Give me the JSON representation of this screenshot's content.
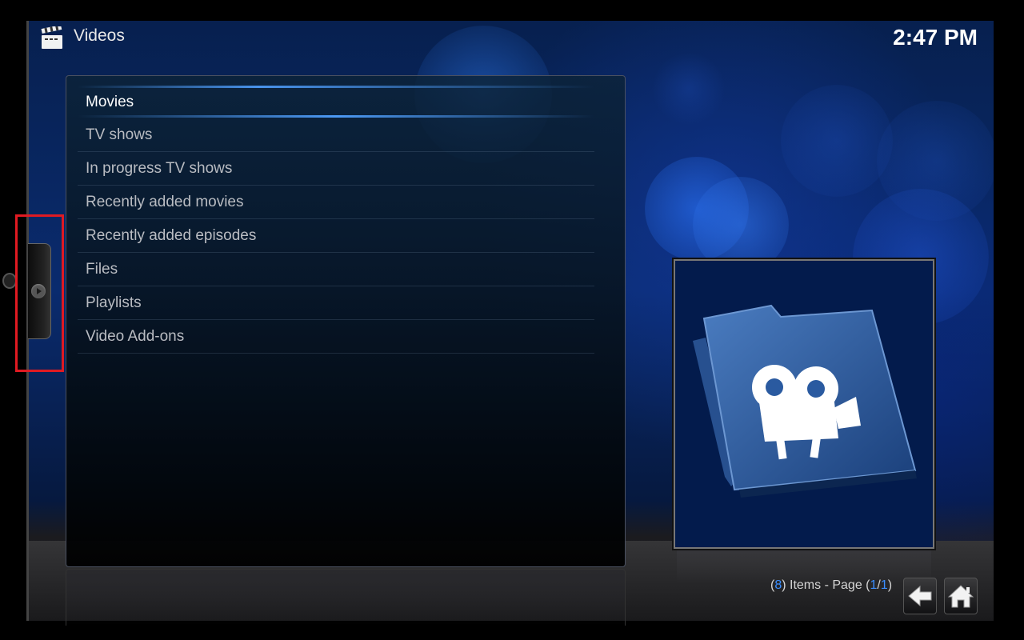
{
  "header": {
    "title": "Videos",
    "icon": "clapperboard-icon",
    "clock": "2:47 PM"
  },
  "side_tab": {
    "icon": "chevron-right-icon"
  },
  "menu": {
    "items": [
      {
        "label": "Movies",
        "focused": true
      },
      {
        "label": "TV shows"
      },
      {
        "label": "In progress TV shows"
      },
      {
        "label": "Recently added movies"
      },
      {
        "label": "Recently added episodes"
      },
      {
        "label": "Files"
      },
      {
        "label": "Playlists"
      },
      {
        "label": "Video Add-ons"
      }
    ]
  },
  "thumbnail": {
    "icon": "video-folder-camera-icon"
  },
  "footer": {
    "items_open": "(",
    "items_count": "8",
    "items_mid": ") Items - Page (",
    "page_current": "1",
    "page_sep": "/",
    "page_total": "1",
    "items_close": ")",
    "back_icon": "back-arrow-icon",
    "home_icon": "home-icon"
  },
  "colors": {
    "accent": "#3a8eff",
    "background": "#0a2b6e",
    "highlight": "#e01a22"
  }
}
